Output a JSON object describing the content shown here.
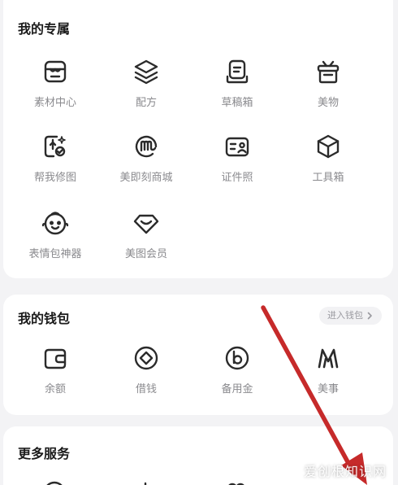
{
  "exclusive": {
    "title": "我的专属",
    "items": [
      {
        "label": "素材中心",
        "icon": "store-icon"
      },
      {
        "label": "配方",
        "icon": "layers-icon"
      },
      {
        "label": "草稿箱",
        "icon": "drafts-icon"
      },
      {
        "label": "美物",
        "icon": "gift-icon"
      },
      {
        "label": "帮我修图",
        "icon": "magic-edit-icon"
      },
      {
        "label": "美即刻商城",
        "icon": "mall-icon"
      },
      {
        "label": "证件照",
        "icon": "id-photo-icon"
      },
      {
        "label": "工具箱",
        "icon": "toolbox-icon"
      },
      {
        "label": "表情包神器",
        "icon": "emoji-face-icon"
      },
      {
        "label": "美图会员",
        "icon": "vip-diamond-icon"
      }
    ]
  },
  "wallet": {
    "title": "我的钱包",
    "enter_label": "进入钱包",
    "items": [
      {
        "label": "余额",
        "icon": "wallet-balance-icon"
      },
      {
        "label": "借钱",
        "icon": "borrow-icon"
      },
      {
        "label": "备用金",
        "icon": "reserve-fund-icon"
      },
      {
        "label": "美事",
        "icon": "meishi-icon"
      }
    ]
  },
  "more": {
    "title": "更多服务"
  },
  "watermark": "爱创根知识网",
  "colors": {
    "icon": "#2b2b2b",
    "label": "#8a8a8e",
    "arrow": "#c62a2a",
    "background": "#f3f3f5"
  }
}
